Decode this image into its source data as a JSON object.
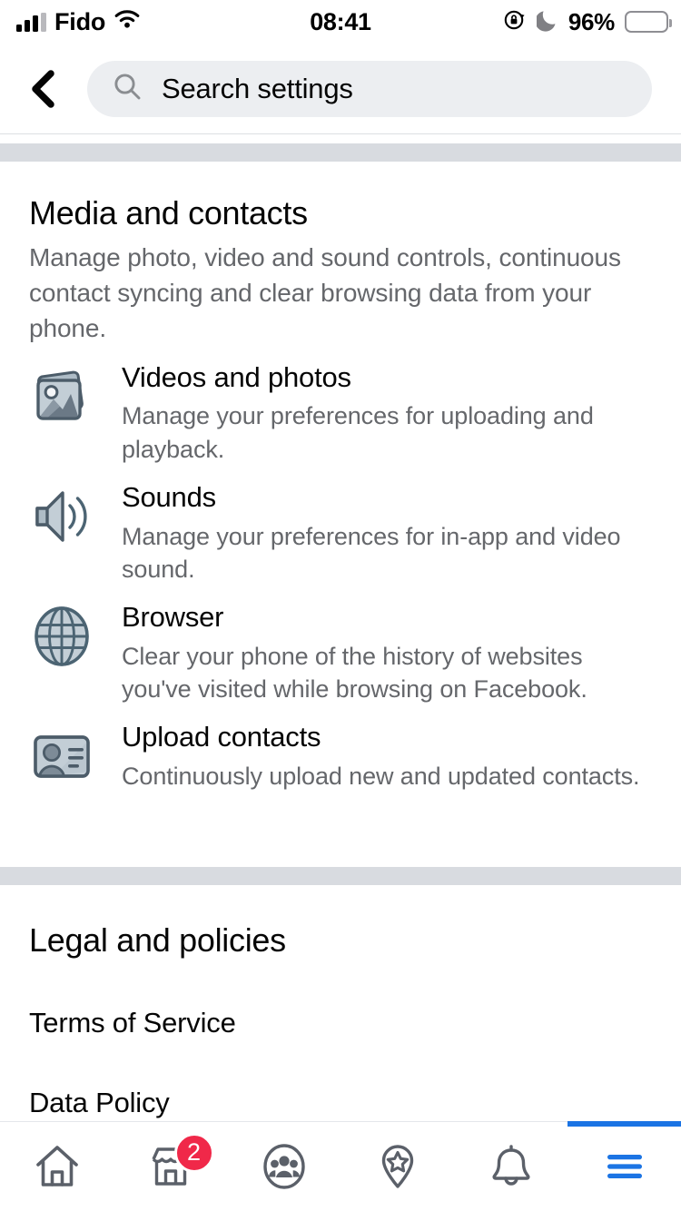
{
  "statusbar": {
    "carrier": "Fido",
    "time": "08:41",
    "battery_pct": "96%",
    "signal_icon": "cellular-signal-icon",
    "wifi_icon": "wifi-icon",
    "rotation_lock_icon": "rotation-lock-icon",
    "do_not_disturb_icon": "moon-icon",
    "battery_icon": "battery-icon",
    "battery_color": "#fecb2e"
  },
  "header": {
    "back_icon": "back-chevron-icon",
    "search_icon": "search-icon",
    "search_value": "",
    "search_placeholder": "Search settings"
  },
  "media_section": {
    "title": "Media and contacts",
    "description": "Manage photo, video and sound controls, continuous contact syncing and clear browsing data from your phone.",
    "items": [
      {
        "icon": "photos-icon",
        "title": "Videos and photos",
        "description": "Manage your preferences for uploading and playback."
      },
      {
        "icon": "speaker-icon",
        "title": "Sounds",
        "description": "Manage your preferences for in-app and video sound."
      },
      {
        "icon": "globe-icon",
        "title": "Browser",
        "description": "Clear your phone of the history of websites you've visited while browsing on Facebook."
      },
      {
        "icon": "contact-card-icon",
        "title": "Upload contacts",
        "description": "Continuously upload new and updated contacts."
      }
    ]
  },
  "legal_section": {
    "title": "Legal and policies",
    "links": [
      {
        "label": "Terms of Service"
      },
      {
        "label": "Data Policy"
      }
    ]
  },
  "bottom_nav": {
    "active_color": "#1b74e4",
    "inactive_color": "#5b6069",
    "badge_color": "#f02849",
    "items": [
      {
        "name": "home",
        "icon": "home-icon",
        "active": false,
        "badge": ""
      },
      {
        "name": "marketplace",
        "icon": "marketplace-store-icon",
        "active": false,
        "badge": "2"
      },
      {
        "name": "groups",
        "icon": "groups-icon",
        "active": false,
        "badge": ""
      },
      {
        "name": "pages",
        "icon": "location-pin-star-icon",
        "active": false,
        "badge": ""
      },
      {
        "name": "notifications",
        "icon": "bell-icon",
        "active": false,
        "badge": ""
      },
      {
        "name": "menu",
        "icon": "hamburger-menu-icon",
        "active": true,
        "badge": ""
      }
    ]
  }
}
